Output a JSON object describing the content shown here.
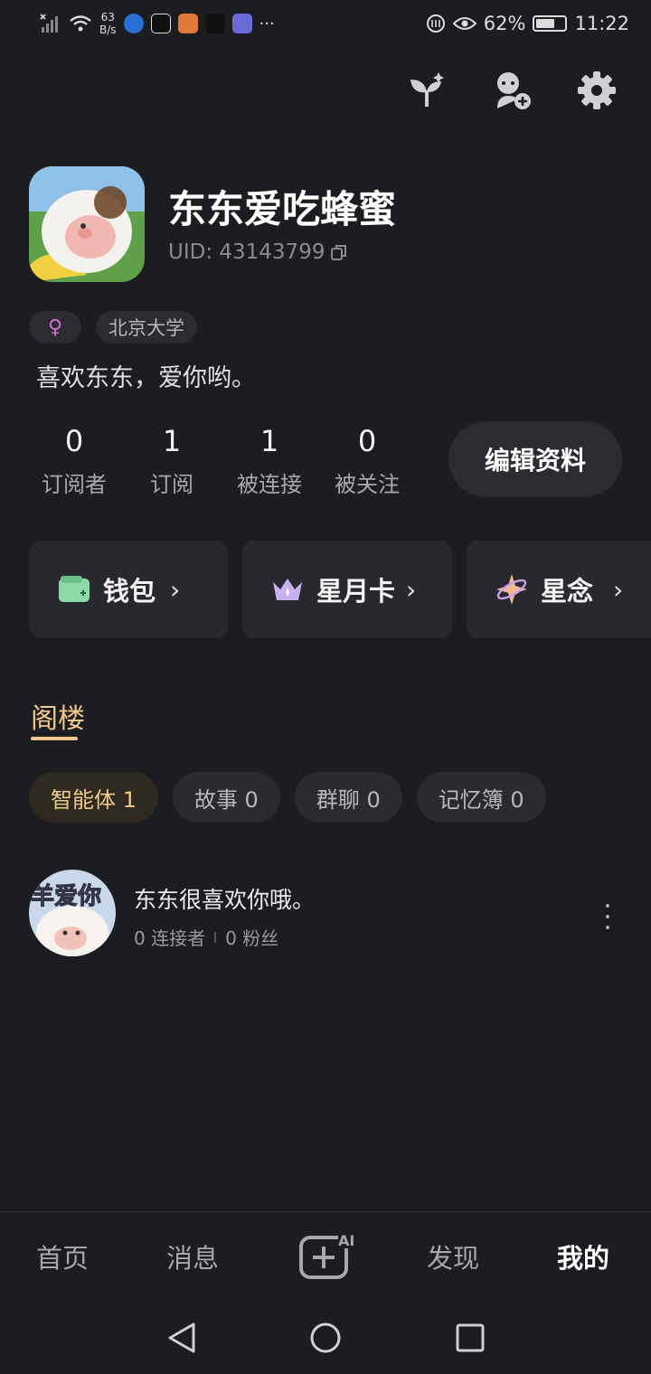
{
  "status_bar": {
    "net_speed_value": "63",
    "net_speed_unit": "B/s",
    "overflow": "···",
    "battery": "62%",
    "time": "11:22"
  },
  "top_actions": [
    "sprout-icon",
    "add-agent-icon",
    "gear-icon"
  ],
  "profile": {
    "name": "东东爱吃蜂蜜",
    "uid": "UID: 43143799",
    "gender_symbol": "♀",
    "school": "北京大学",
    "bio": "喜欢东东，爱你哟。"
  },
  "stats": [
    {
      "value": "0",
      "label": "订阅者"
    },
    {
      "value": "1",
      "label": "订阅"
    },
    {
      "value": "1",
      "label": "被连接"
    },
    {
      "value": "0",
      "label": "被关注"
    }
  ],
  "edit_profile_label": "编辑资料",
  "cards": [
    {
      "label": "钱包",
      "icon": "wallet-icon"
    },
    {
      "label": "星月卡",
      "icon": "crown-icon"
    },
    {
      "label": "星念",
      "icon": "sparkle-planet-icon"
    }
  ],
  "section": {
    "title": "阁楼"
  },
  "filters": [
    {
      "label": "智能体 1",
      "active": true
    },
    {
      "label": "故事 0",
      "active": false
    },
    {
      "label": "群聊 0",
      "active": false
    },
    {
      "label": "记忆簿 0",
      "active": false
    }
  ],
  "agent_item": {
    "avatar_text": "羊爱你",
    "title": "东东很喜欢你哦。",
    "connectors": "0 连接者",
    "fans": "0 粉丝"
  },
  "bottom_nav": {
    "home": "首页",
    "messages": "消息",
    "create_ai_badge": "AI",
    "discover": "发现",
    "mine": "我的"
  },
  "colors": {
    "background": "#1c1d21",
    "accent_gold": "#f0c98a",
    "card_bg": "#28292e"
  }
}
